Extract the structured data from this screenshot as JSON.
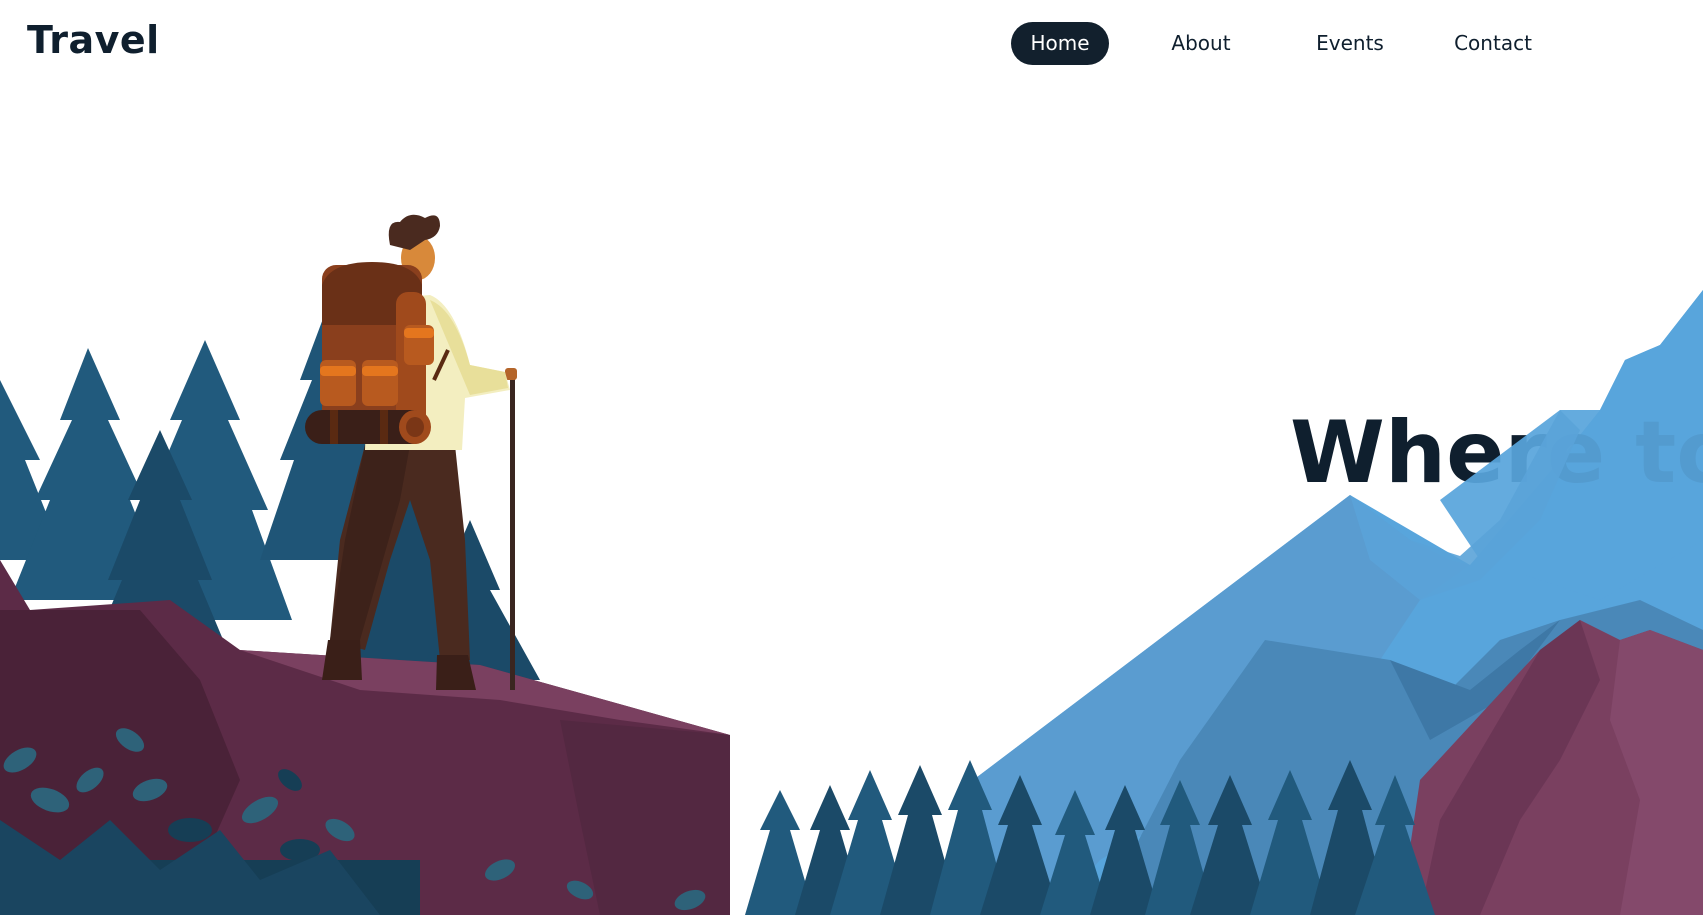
{
  "header": {
    "logo": "Travel"
  },
  "nav": {
    "items": [
      {
        "label": "Home",
        "active": true
      },
      {
        "label": "About",
        "active": false
      },
      {
        "label": "Events",
        "active": false
      },
      {
        "label": "Contact",
        "active": false
      }
    ]
  },
  "hero": {
    "headline": "Where to"
  },
  "colors": {
    "dark_navy": "#12202d",
    "mountain_blue": "#58a5dc",
    "mountain_blue_shade": "#4a88b8",
    "pine_dark": "#1b4a68",
    "pine_mid": "#215a7d",
    "rock_plum": "#5c2b47",
    "rock_plum_light": "#7a4060",
    "backpack_brown": "#8a3f1d",
    "backpack_orange": "#e4761e",
    "shirt_cream": "#f3eec0"
  }
}
